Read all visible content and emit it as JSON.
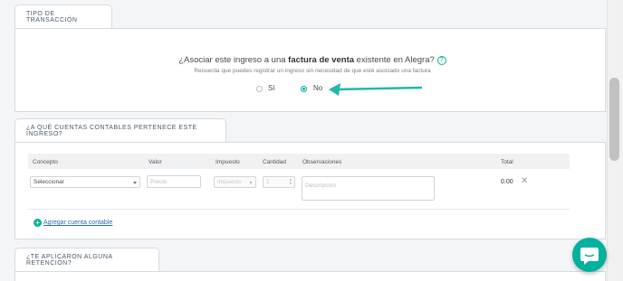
{
  "section1": {
    "tab_label": "Tipo de transacción",
    "question_prefix": "¿Asociar este ingreso a una ",
    "question_bold": "factura de venta",
    "question_suffix": " existente en Alegra?",
    "help_glyph": "?",
    "hint": "Recuerda que puedes registrar un ingreso sin necesidad de que esté asociado una factura",
    "options": [
      {
        "label": "Sí",
        "checked": false
      },
      {
        "label": "No",
        "checked": true
      }
    ]
  },
  "section2": {
    "tab_label": "¿A qué cuentas contables pertenece este ingreso?",
    "columns": [
      "Concepto",
      "Valor",
      "Impuesto",
      "Cantidad",
      "Observaciones",
      "Total"
    ],
    "row": {
      "concepto": "Seleccionar",
      "valor_placeholder": "Precio",
      "impuesto": "Impuesto",
      "cantidad": "1",
      "observaciones_placeholder": "Descripción",
      "total": "0.00",
      "remove_glyph": "✕"
    },
    "add_label": "Agregar cuenta contable",
    "add_glyph": "+"
  },
  "section3": {
    "tab_label": "¿Te aplicaron alguna retención?"
  },
  "accent_color": "#00b19d",
  "arrow_color": "#22b8a8"
}
